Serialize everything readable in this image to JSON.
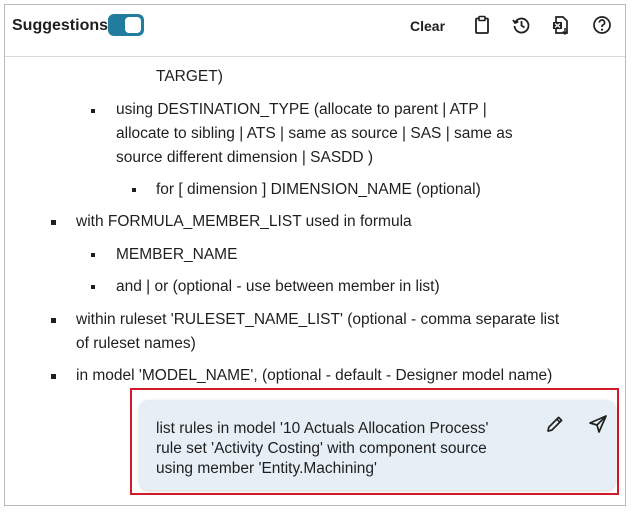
{
  "header": {
    "title": "Suggestions",
    "toggle_on": true,
    "clear_label": "Clear",
    "icons": [
      "clipboard-icon",
      "history-icon",
      "export-file-icon",
      "help-icon"
    ],
    "accent_color": "#227c9d"
  },
  "content": {
    "lines": [
      "TARGET)",
      "using DESTINATION_TYPE (allocate to parent | ATP |",
      "allocate to sibling | ATS | same as source | SAS | same as",
      "source different dimension | SASDD )",
      "for [ dimension ] DIMENSION_NAME (optional)",
      "with FORMULA_MEMBER_LIST used in formula",
      "MEMBER_NAME",
      "and | or (optional - use between member in list)",
      "within ruleset 'RULESET_NAME_LIST' (optional - comma separate list",
      "of ruleset names)",
      "in model 'MODEL_NAME', (optional - default - Designer model name)"
    ]
  },
  "prompt": {
    "lines": [
      "list rules in model '10 Actuals Allocation Process'",
      "rule set 'Activity Costing' with component source",
      "using member 'Entity.Machining'"
    ],
    "highlight_color": "#d11a2a"
  }
}
